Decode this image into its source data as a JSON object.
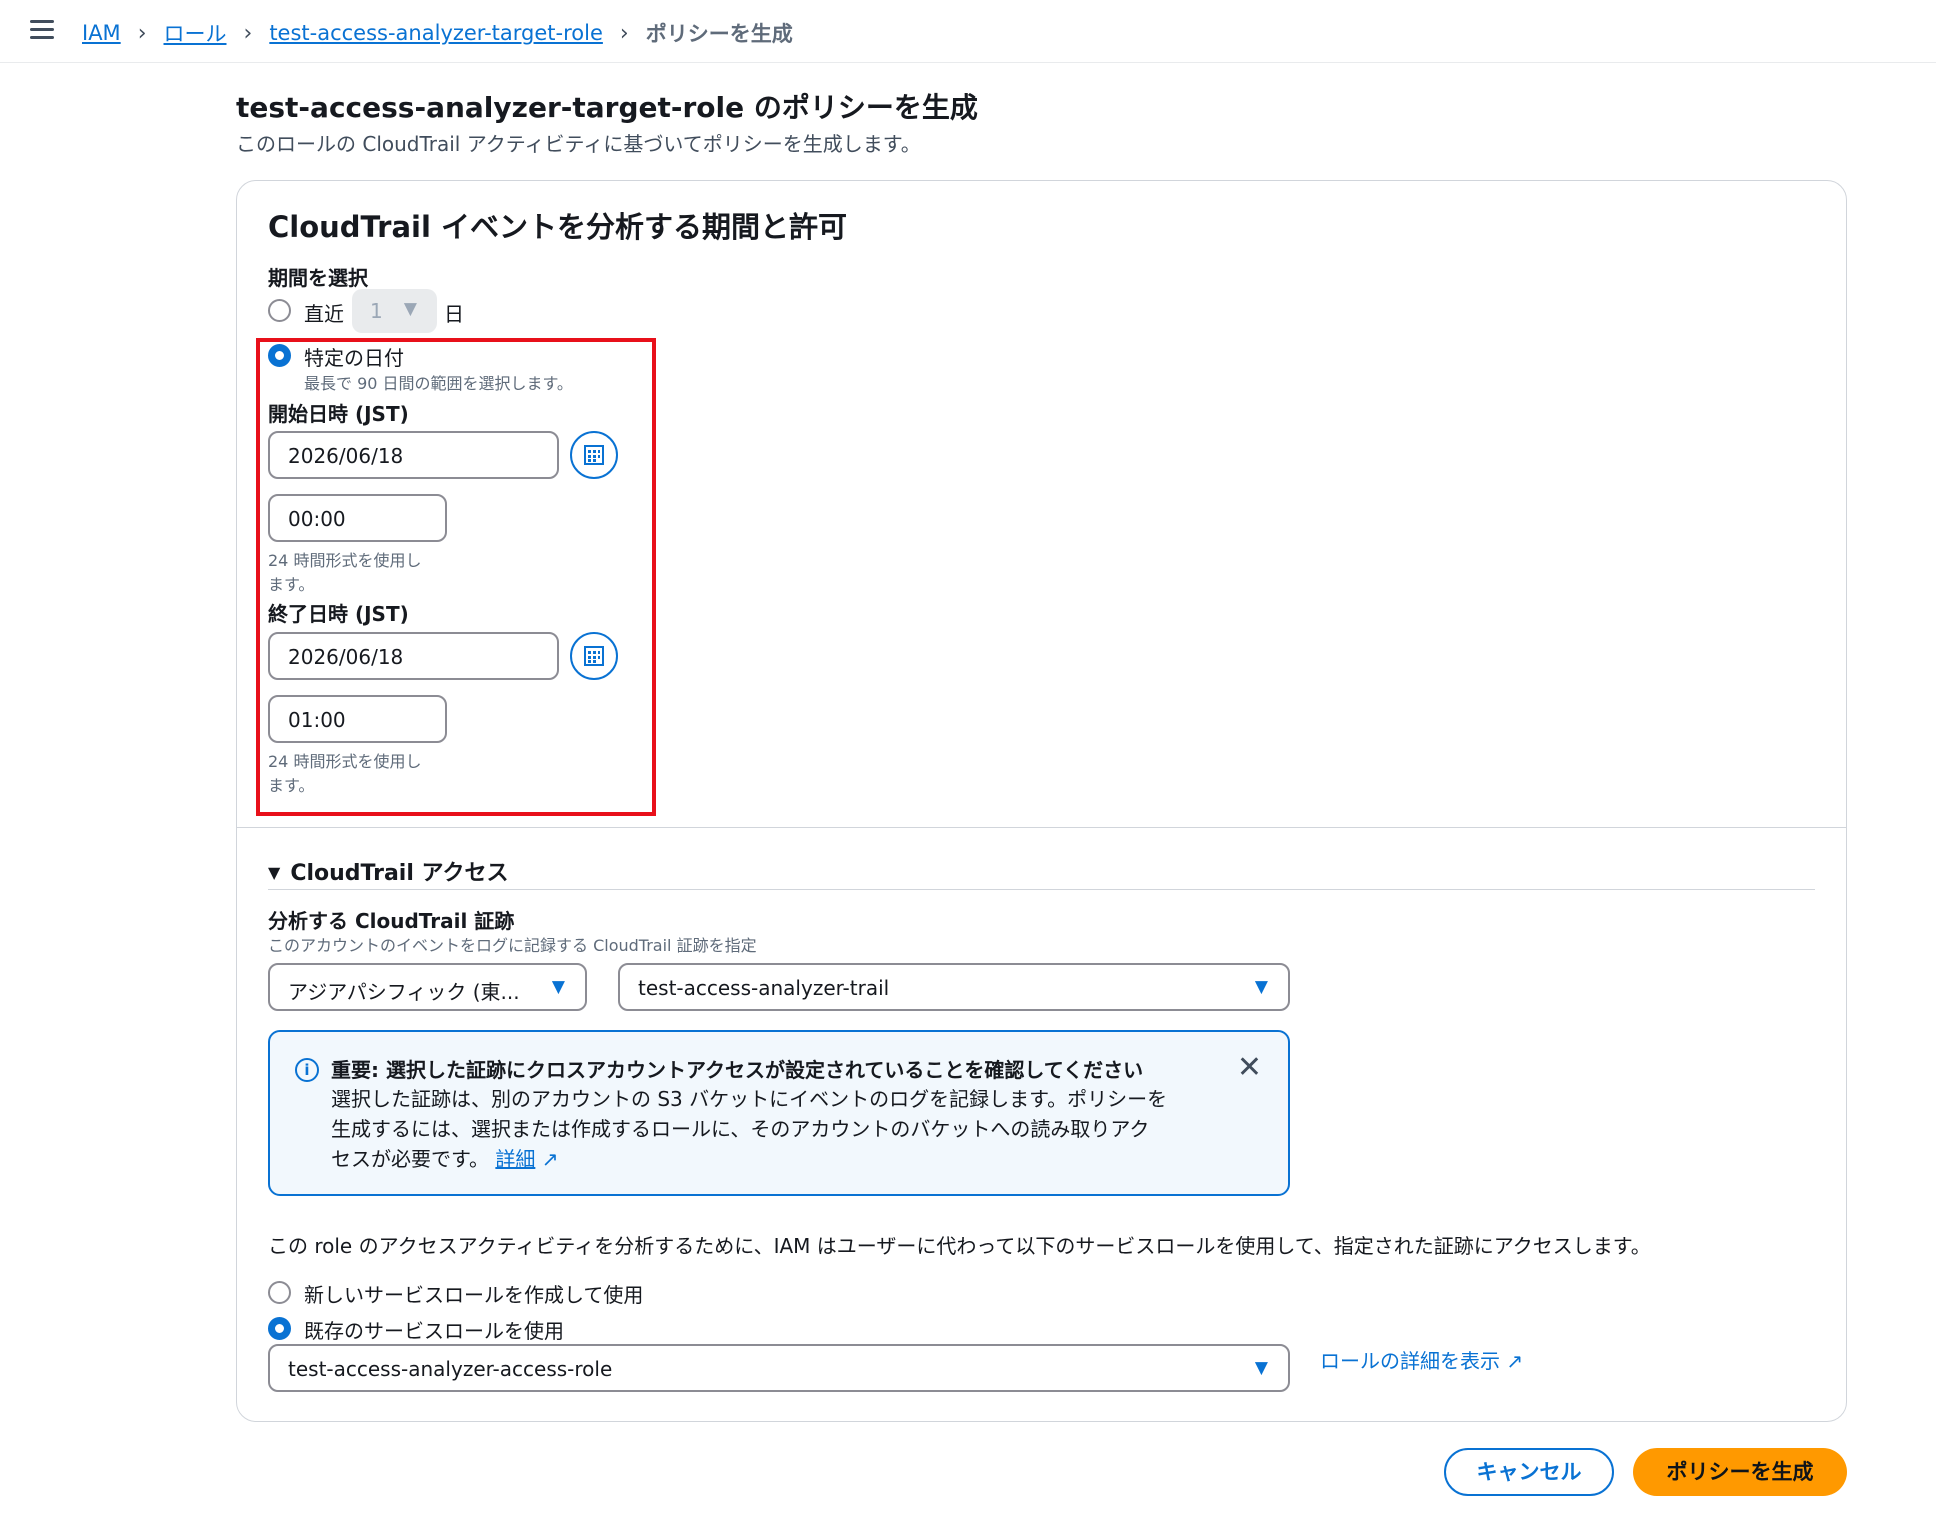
{
  "breadcrumb": {
    "items": [
      "IAM",
      "ロール",
      "test-access-analyzer-target-role"
    ],
    "current": "ポリシーを生成"
  },
  "page": {
    "title": "test-access-analyzer-target-role のポリシーを生成",
    "description": "このロールの CloudTrail アクティビティに基づいてポリシーを生成します。"
  },
  "period": {
    "section_title": "CloudTrail イベントを分析する期間と許可",
    "select_label": "期間を選択",
    "recent_label": "直近",
    "recent_value": "1",
    "recent_unit": "日",
    "specific_label": "特定の日付",
    "specific_hint": "最長で 90 日間の範囲を選択します。",
    "selected": "specific",
    "start_label": "開始日時 (JST)",
    "start_date": "2026/06/18",
    "start_time": "00:00",
    "start_time_hint_1": "24 時間形式を使用し",
    "start_time_hint_2": "ます。",
    "end_label": "終了日時 (JST)",
    "end_date": "2026/06/18",
    "end_time": "01:00",
    "end_time_hint_1": "24 時間形式を使用し",
    "end_time_hint_2": "ます。"
  },
  "access": {
    "section_title": "CloudTrail アクセス",
    "trail_label": "分析する CloudTrail 証跡",
    "trail_hint": "このアカウントのイベントをログに記録する CloudTrail 証跡を指定",
    "region_value": "アジアパシフィック (東...",
    "trail_value": "test-access-analyzer-trail",
    "alert": {
      "icon": "info-icon",
      "heading": "重要: 選択した証跡にクロスアカウントアクセスが設定されていることを確認してください",
      "body_1": "選択した証跡は、別のアカウントの S3 バケットにイベントのログを記録します。ポリシーを",
      "body_2": "生成するには、選択または作成するロールに、そのアカウントのバケットへの読み取りアク",
      "body_3": "セスが必要です。",
      "link": "詳細"
    },
    "service_role_note": "この role のアクセスアクティビティを分析するために、IAM はユーザーに代わって以下のサービスロールを使用して、指定された証跡にアクセスします。",
    "new_role_label": "新しいサービスロールを作成して使用",
    "existing_role_label": "既存のサービスロールを使用",
    "selected": "existing",
    "role_value": "test-access-analyzer-access-role",
    "role_details_link": "ロールの詳細を表示"
  },
  "actions": {
    "cancel": "キャンセル",
    "generate": "ポリシーを生成"
  },
  "colors": {
    "link": "#0972d3",
    "primary_button": "#ff9900",
    "highlight_box": "#e8101a"
  }
}
